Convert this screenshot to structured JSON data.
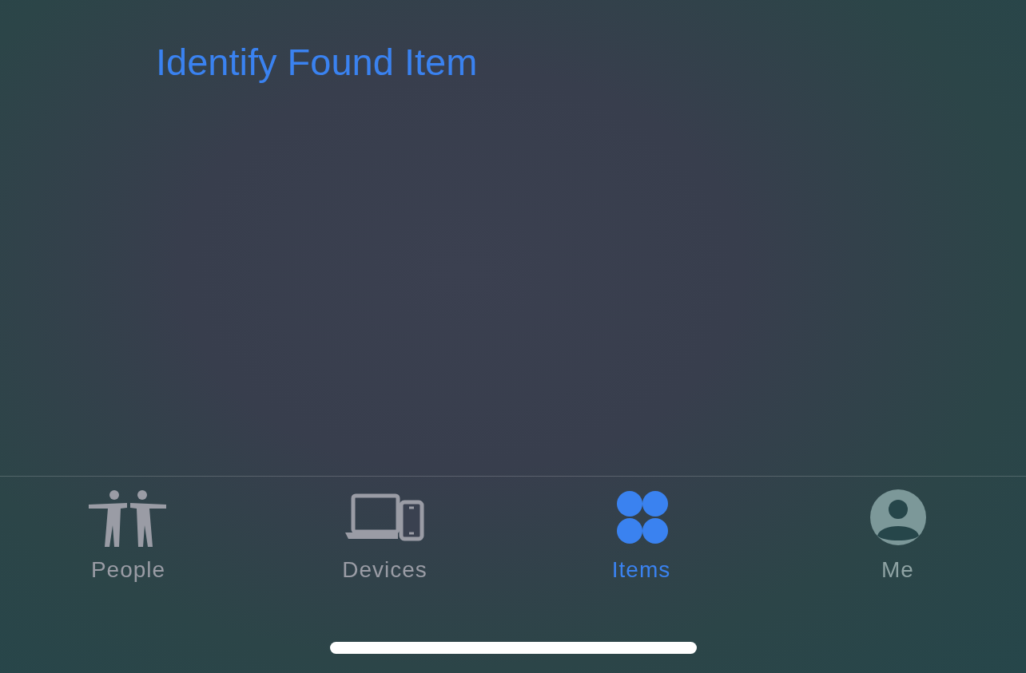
{
  "header_link": {
    "text": "Identify Found Item"
  },
  "tabs": [
    {
      "label": "People",
      "kind": "people",
      "selected": false
    },
    {
      "label": "Devices",
      "kind": "devices",
      "selected": false
    },
    {
      "label": "Items",
      "kind": "items",
      "selected": true
    },
    {
      "label": "Me",
      "kind": "me",
      "selected": false
    }
  ]
}
